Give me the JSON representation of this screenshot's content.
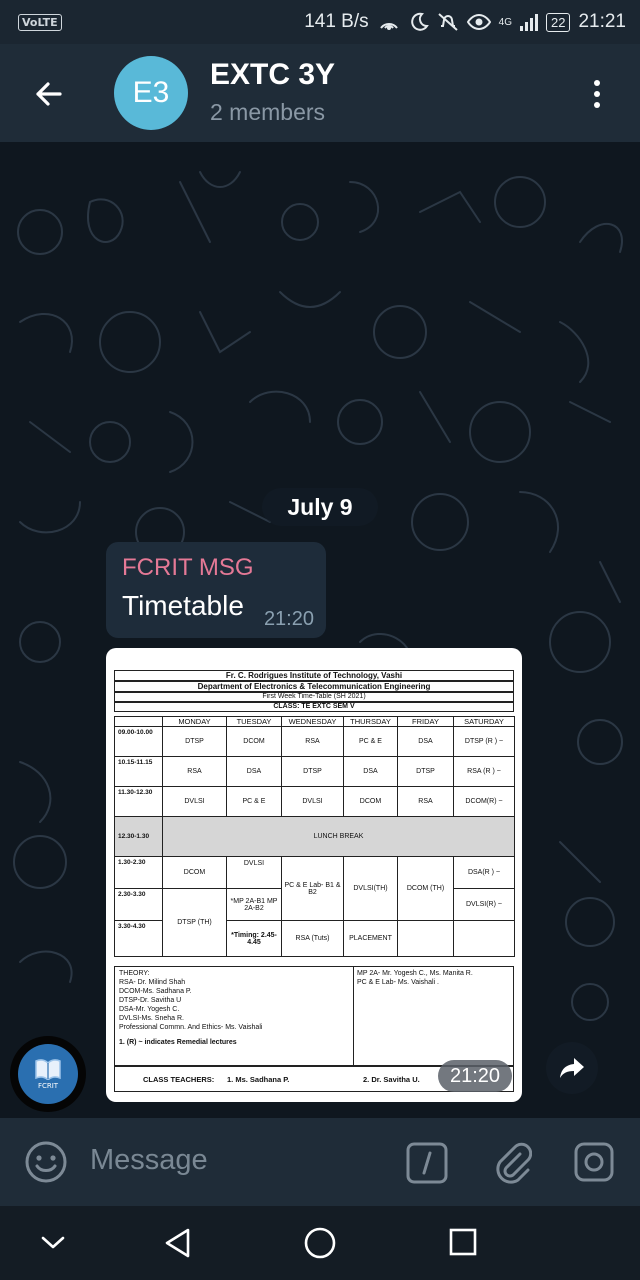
{
  "status_bar": {
    "volte": "VoLTE",
    "net_speed": "141 B/s",
    "network": "4G",
    "battery": "22",
    "time": "21:21"
  },
  "header": {
    "avatar_initials": "E3",
    "title": "EXTC 3Y",
    "subtitle": "2 members"
  },
  "chat": {
    "date_label": "July 9",
    "message": {
      "sender": "FCRIT MSG",
      "text": "Timetable",
      "time": "21:20"
    },
    "photo_time": "21:20",
    "sender_avatar_label": "FCRIT"
  },
  "timetable": {
    "institute": "Fr. C. Rodrigues Institute of Technology, Vashi",
    "department": "Department of Electronics & Telecommunication Engineering",
    "subtitle": "First Week Time-Table (SH 2021)",
    "class": "CLASS:  TE EXTC SEM V",
    "days": [
      "MONDAY",
      "TUESDAY",
      "WEDNESDAY",
      "THURSDAY",
      "FRIDAY",
      "SATURDAY"
    ],
    "slot1": {
      "time": "09.00-10.00",
      "cells": [
        "DTSP",
        "DCOM",
        "RSA",
        "PC & E",
        "DSA",
        "DTSP (R ) ~"
      ]
    },
    "slot2": {
      "time": "10.15-11.15",
      "cells": [
        "RSA",
        "DSA",
        "DTSP",
        "DSA",
        "DTSP",
        "RSA (R ) ~"
      ]
    },
    "slot3": {
      "time": "11.30-12.30",
      "cells": [
        "DVLSI",
        "PC & E",
        "DVLSI",
        "DCOM",
        "RSA",
        "DCOM(R) ~"
      ]
    },
    "lunch": {
      "time": "12.30-1.30",
      "label": "LUNCH BREAK"
    },
    "slot5": {
      "time": "1.30-2.30",
      "mon": "DCOM",
      "tue": "DVLSI",
      "wed": "PC & E Lab- B1 & B2",
      "fri": "DCOM (TH)",
      "sat": "DSA(R ) ~"
    },
    "slot6": {
      "time": "2.30-3.30",
      "mon": "DTSP (TH)",
      "tue": "*MP 2A-B1 MP 2A-B2",
      "thu": "DVLSI(TH)",
      "sat": "DVLSI(R) ~"
    },
    "slot7": {
      "time": "3.30-4.30",
      "tue": "*Timing: 2.45-4.45",
      "wed": "RSA (Tuts)",
      "thu": "PLACEMENT"
    },
    "theory_heading": "THEORY:",
    "theory": [
      "RSA- Dr. Milind Shah",
      "DCOM-Ms. Sadhana P.",
      "DTSP-Dr. Savitha U",
      "DSA-Mr. Yogesh C.",
      "DVLSI-Ms. Sneha R.",
      "Professional Commn. And Ethics- Ms. Vaishali"
    ],
    "remedial_note": "1. (R) ~ indicates Remedial lectures",
    "labs": [
      "MP 2A- Mr. Yogesh C., Ms. Manita R.",
      "PC & E Lab- Ms. Vaishali ."
    ],
    "class_teachers_label": "CLASS TEACHERS:",
    "teacher1": "1. Ms. Sadhana P.",
    "teacher2": "2.  Dr. Savitha U."
  },
  "composer": {
    "placeholder": "Message"
  }
}
